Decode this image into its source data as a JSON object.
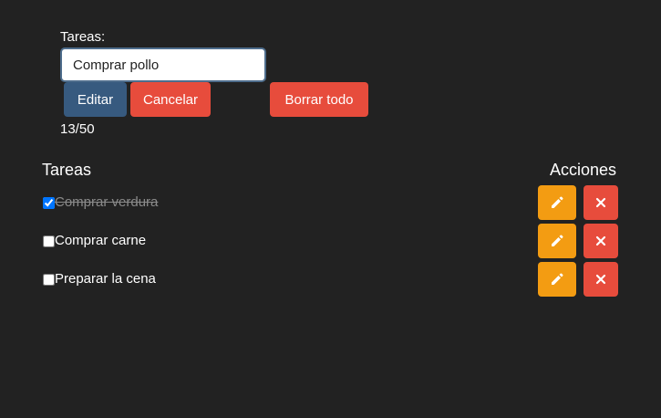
{
  "form": {
    "label": "Tareas:",
    "input_value": "Comprar pollo",
    "edit_label": "Editar",
    "cancel_label": "Cancelar",
    "clear_label": "Borrar todo",
    "counter": "13/50"
  },
  "list": {
    "tasks_heading": "Tareas",
    "actions_heading": "Acciones",
    "items": [
      {
        "label": "Comprar verdura",
        "done": true
      },
      {
        "label": "Comprar carne",
        "done": false
      },
      {
        "label": "Preparar la cena",
        "done": false
      }
    ]
  },
  "colors": {
    "background": "#222222",
    "primary": "#375a7f",
    "danger": "#e74c3c",
    "warning": "#f39c12"
  },
  "icons": {
    "edit": "pencil-icon",
    "delete": "close-icon"
  }
}
